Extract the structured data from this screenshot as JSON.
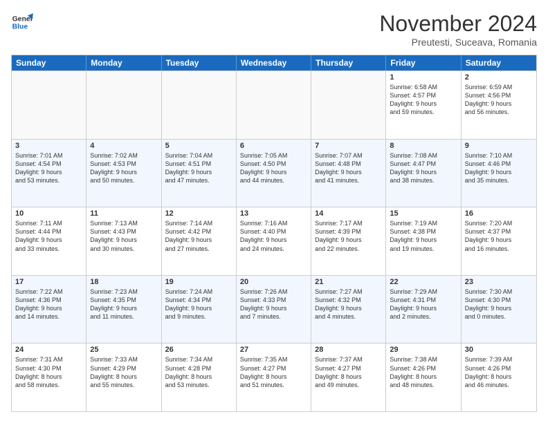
{
  "header": {
    "logo_line1": "General",
    "logo_line2": "Blue",
    "month": "November 2024",
    "location": "Preutesti, Suceava, Romania"
  },
  "days_of_week": [
    "Sunday",
    "Monday",
    "Tuesday",
    "Wednesday",
    "Thursday",
    "Friday",
    "Saturday"
  ],
  "weeks": [
    [
      {
        "day": "",
        "info": ""
      },
      {
        "day": "",
        "info": ""
      },
      {
        "day": "",
        "info": ""
      },
      {
        "day": "",
        "info": ""
      },
      {
        "day": "",
        "info": ""
      },
      {
        "day": "1",
        "info": "Sunrise: 6:58 AM\nSunset: 4:57 PM\nDaylight: 9 hours\nand 59 minutes."
      },
      {
        "day": "2",
        "info": "Sunrise: 6:59 AM\nSunset: 4:56 PM\nDaylight: 9 hours\nand 56 minutes."
      }
    ],
    [
      {
        "day": "3",
        "info": "Sunrise: 7:01 AM\nSunset: 4:54 PM\nDaylight: 9 hours\nand 53 minutes."
      },
      {
        "day": "4",
        "info": "Sunrise: 7:02 AM\nSunset: 4:53 PM\nDaylight: 9 hours\nand 50 minutes."
      },
      {
        "day": "5",
        "info": "Sunrise: 7:04 AM\nSunset: 4:51 PM\nDaylight: 9 hours\nand 47 minutes."
      },
      {
        "day": "6",
        "info": "Sunrise: 7:05 AM\nSunset: 4:50 PM\nDaylight: 9 hours\nand 44 minutes."
      },
      {
        "day": "7",
        "info": "Sunrise: 7:07 AM\nSunset: 4:48 PM\nDaylight: 9 hours\nand 41 minutes."
      },
      {
        "day": "8",
        "info": "Sunrise: 7:08 AM\nSunset: 4:47 PM\nDaylight: 9 hours\nand 38 minutes."
      },
      {
        "day": "9",
        "info": "Sunrise: 7:10 AM\nSunset: 4:46 PM\nDaylight: 9 hours\nand 35 minutes."
      }
    ],
    [
      {
        "day": "10",
        "info": "Sunrise: 7:11 AM\nSunset: 4:44 PM\nDaylight: 9 hours\nand 33 minutes."
      },
      {
        "day": "11",
        "info": "Sunrise: 7:13 AM\nSunset: 4:43 PM\nDaylight: 9 hours\nand 30 minutes."
      },
      {
        "day": "12",
        "info": "Sunrise: 7:14 AM\nSunset: 4:42 PM\nDaylight: 9 hours\nand 27 minutes."
      },
      {
        "day": "13",
        "info": "Sunrise: 7:16 AM\nSunset: 4:40 PM\nDaylight: 9 hours\nand 24 minutes."
      },
      {
        "day": "14",
        "info": "Sunrise: 7:17 AM\nSunset: 4:39 PM\nDaylight: 9 hours\nand 22 minutes."
      },
      {
        "day": "15",
        "info": "Sunrise: 7:19 AM\nSunset: 4:38 PM\nDaylight: 9 hours\nand 19 minutes."
      },
      {
        "day": "16",
        "info": "Sunrise: 7:20 AM\nSunset: 4:37 PM\nDaylight: 9 hours\nand 16 minutes."
      }
    ],
    [
      {
        "day": "17",
        "info": "Sunrise: 7:22 AM\nSunset: 4:36 PM\nDaylight: 9 hours\nand 14 minutes."
      },
      {
        "day": "18",
        "info": "Sunrise: 7:23 AM\nSunset: 4:35 PM\nDaylight: 9 hours\nand 11 minutes."
      },
      {
        "day": "19",
        "info": "Sunrise: 7:24 AM\nSunset: 4:34 PM\nDaylight: 9 hours\nand 9 minutes."
      },
      {
        "day": "20",
        "info": "Sunrise: 7:26 AM\nSunset: 4:33 PM\nDaylight: 9 hours\nand 7 minutes."
      },
      {
        "day": "21",
        "info": "Sunrise: 7:27 AM\nSunset: 4:32 PM\nDaylight: 9 hours\nand 4 minutes."
      },
      {
        "day": "22",
        "info": "Sunrise: 7:29 AM\nSunset: 4:31 PM\nDaylight: 9 hours\nand 2 minutes."
      },
      {
        "day": "23",
        "info": "Sunrise: 7:30 AM\nSunset: 4:30 PM\nDaylight: 9 hours\nand 0 minutes."
      }
    ],
    [
      {
        "day": "24",
        "info": "Sunrise: 7:31 AM\nSunset: 4:30 PM\nDaylight: 8 hours\nand 58 minutes."
      },
      {
        "day": "25",
        "info": "Sunrise: 7:33 AM\nSunset: 4:29 PM\nDaylight: 8 hours\nand 55 minutes."
      },
      {
        "day": "26",
        "info": "Sunrise: 7:34 AM\nSunset: 4:28 PM\nDaylight: 8 hours\nand 53 minutes."
      },
      {
        "day": "27",
        "info": "Sunrise: 7:35 AM\nSunset: 4:27 PM\nDaylight: 8 hours\nand 51 minutes."
      },
      {
        "day": "28",
        "info": "Sunrise: 7:37 AM\nSunset: 4:27 PM\nDaylight: 8 hours\nand 49 minutes."
      },
      {
        "day": "29",
        "info": "Sunrise: 7:38 AM\nSunset: 4:26 PM\nDaylight: 8 hours\nand 48 minutes."
      },
      {
        "day": "30",
        "info": "Sunrise: 7:39 AM\nSunset: 4:26 PM\nDaylight: 8 hours\nand 46 minutes."
      }
    ]
  ]
}
